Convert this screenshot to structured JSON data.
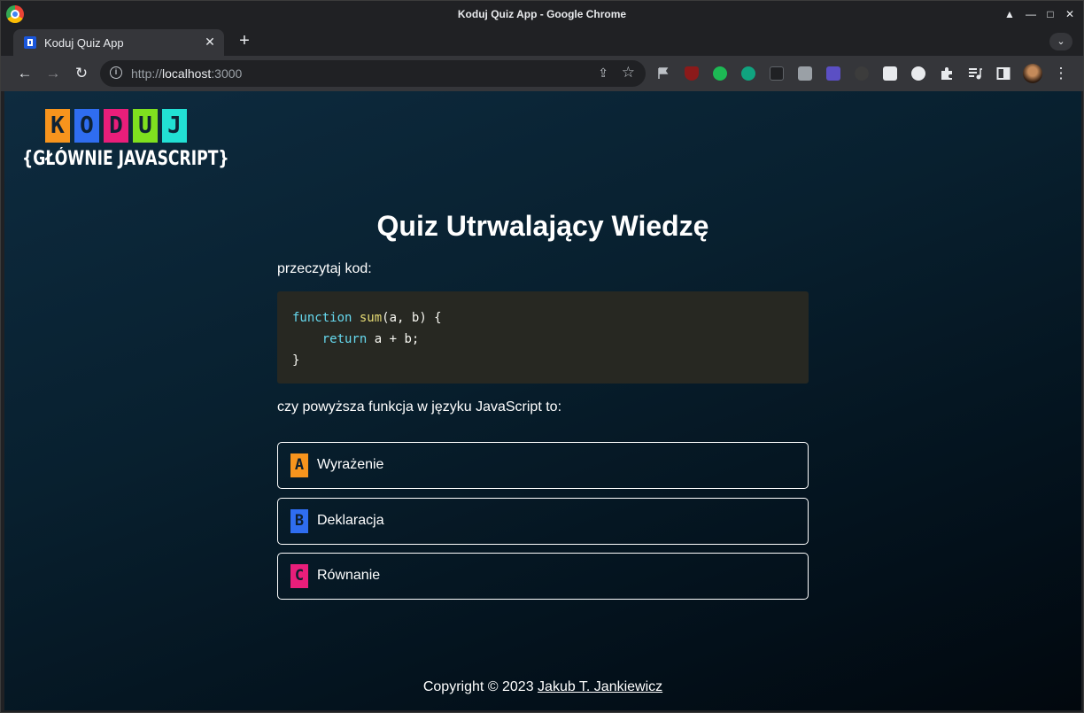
{
  "window": {
    "title": "Koduj Quiz App - Google Chrome",
    "controls": [
      "▲",
      "—",
      "□",
      "✕"
    ]
  },
  "tab": {
    "title": "Koduj Quiz App",
    "close": "✕",
    "new_tab": "+",
    "menu": "⌄"
  },
  "toolbar": {
    "back": "←",
    "forward": "→",
    "reload": "↻",
    "url_scheme": "http://",
    "url_host": "localhost",
    "url_port": ":3000",
    "share": "⇪",
    "star": "☆",
    "extension_badge": "off",
    "menu": "⋮"
  },
  "colors": {
    "letter_k": "#f7941d",
    "letter_o": "#2f6df0",
    "letter_d": "#e91e7a",
    "letter_u": "#7fe01f",
    "letter_j": "#22e0d4",
    "answer_a": "#f7941d",
    "answer_b": "#2f6df0",
    "answer_c": "#e91e7a"
  },
  "logo": {
    "letters": [
      "K",
      "O",
      "D",
      "U",
      "J"
    ],
    "subtitle": "{GŁÓWNIE JAVASCRIPT}"
  },
  "quiz": {
    "title": "Quiz Utrwalający Wiedzę",
    "intro": "przeczytaj kod:",
    "code": {
      "line1_kw": "function",
      "line1_fn": "sum",
      "line1_rest": "(a, b) {",
      "line2_indent": "    ",
      "line2_kw": "return",
      "line2_rest": " a + b;",
      "line3": "}"
    },
    "question": "czy powyższa funkcja w języku JavaScript to:",
    "answers": [
      {
        "letter": "A",
        "label": "Wyrażenie"
      },
      {
        "letter": "B",
        "label": "Deklaracja"
      },
      {
        "letter": "C",
        "label": "Równanie"
      }
    ]
  },
  "footer": {
    "copyright": "Copyright © 2023 ",
    "author": "Jakub T. Jankiewicz"
  }
}
